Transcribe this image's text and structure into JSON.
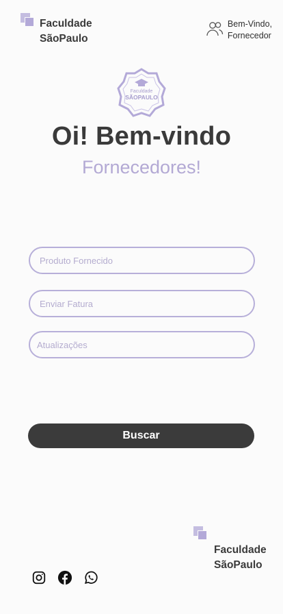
{
  "header": {
    "brand_line1": "Faculdade",
    "brand_line2": "SãoPaulo",
    "user_line1": "Bem-Vindo,",
    "user_line2": "Fornecedor"
  },
  "seal": {
    "line1": "Faculdade",
    "line2": "SÃOPAULO"
  },
  "hero": {
    "title": "Oi! Bem-vindo",
    "subtitle": "Fornecedores!"
  },
  "form": {
    "field1_placeholder": "Produto Fornecido",
    "field2_placeholder": "Enviar Fatura",
    "field3_placeholder": "Atualizações",
    "submit_label": "Buscar"
  },
  "footer": {
    "brand_line1": "Faculdade",
    "brand_line2": "SãoPaulo",
    "socials": [
      "instagram-icon",
      "facebook-icon",
      "whatsapp-icon"
    ]
  },
  "colors": {
    "accent": "#b3a9d8",
    "dark": "#3b3b3b",
    "background": "#fbfbfb"
  }
}
